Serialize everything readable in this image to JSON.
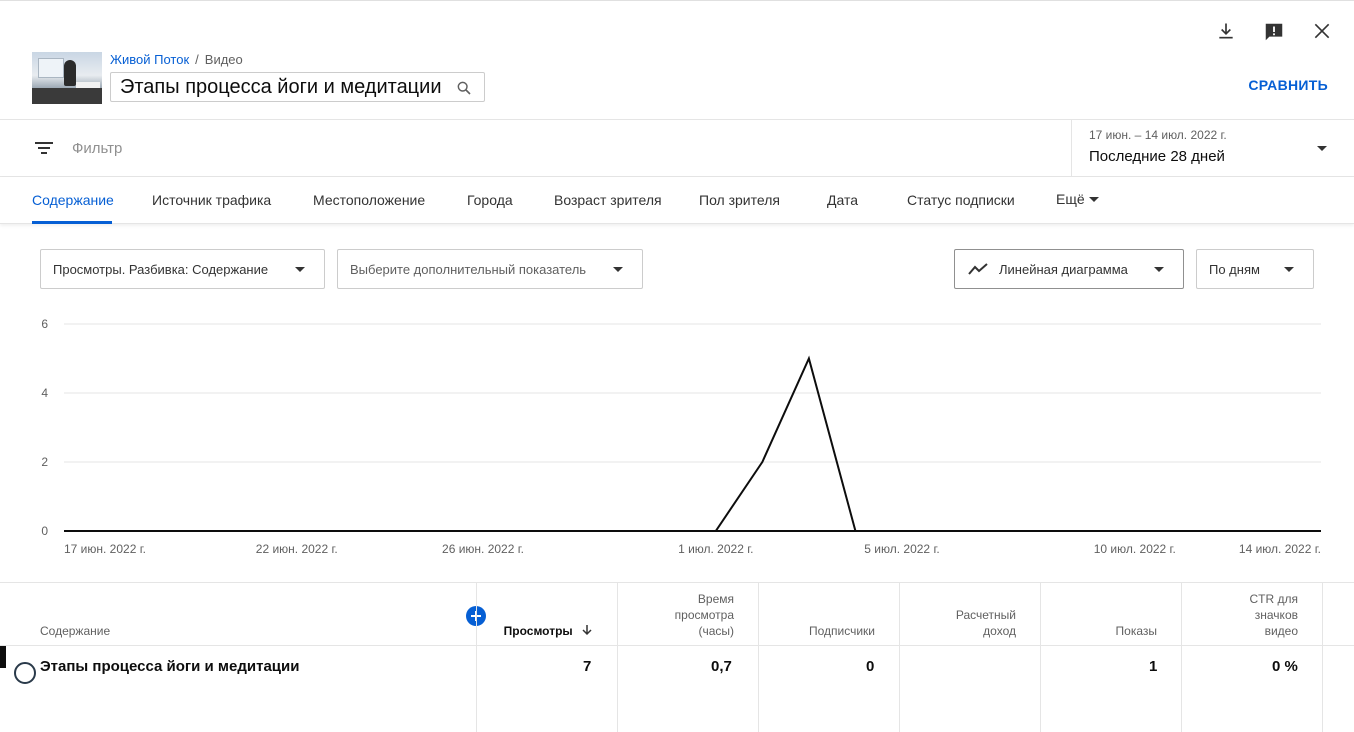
{
  "header": {
    "breadcrumb_channel": "Живой Поток",
    "breadcrumb_separator": "/",
    "breadcrumb_section": "Видео",
    "video_title": "Этапы процесса йоги и медитации",
    "compare_label": "СРАВНИТЬ",
    "icons": [
      "download-icon",
      "feedback-icon",
      "close-icon",
      "search-icon"
    ]
  },
  "filter": {
    "placeholder": "Фильтр",
    "date_range": "17 июн. – 14 июл. 2022 г.",
    "date_preset": "Последние 28 дней"
  },
  "tabs": [
    {
      "label": "Содержание",
      "active": true
    },
    {
      "label": "Источник трафика"
    },
    {
      "label": "Местоположение"
    },
    {
      "label": "Города"
    },
    {
      "label": "Возраст зрителя"
    },
    {
      "label": "Пол зрителя"
    },
    {
      "label": "Дата"
    },
    {
      "label": "Статус подписки"
    },
    {
      "label": "Ещё"
    }
  ],
  "controls": {
    "metric": "Просмотры. Разбивка: Содержание",
    "secondary_metric": "Выберите дополнительный показатель",
    "chart_type": "Линейная диаграмма",
    "interval": "По дням"
  },
  "chart_data": {
    "type": "line",
    "x": [
      "17 июн.",
      "18 июн.",
      "19 июн.",
      "20 июн.",
      "21 июн.",
      "22 июн.",
      "23 июн.",
      "24 июн.",
      "25 июн.",
      "26 июн.",
      "27 июн.",
      "28 июн.",
      "29 июн.",
      "30 июн.",
      "1 июл.",
      "2 июл.",
      "3 июл.",
      "4 июл.",
      "5 июл.",
      "6 июл.",
      "7 июл.",
      "8 июл.",
      "9 июл.",
      "10 июл.",
      "11 июл.",
      "12 июл.",
      "13 июл.",
      "14 июл."
    ],
    "series": [
      {
        "values": [
          0,
          0,
          0,
          0,
          0,
          0,
          0,
          0,
          0,
          0,
          0,
          0,
          0,
          0,
          0,
          2,
          5,
          0,
          0,
          0,
          0,
          0,
          0,
          0,
          0,
          0,
          0,
          0
        ]
      }
    ],
    "ylim": [
      0,
      6
    ],
    "yticks": [
      "0",
      "2",
      "4",
      "6"
    ],
    "xtick_labels": [
      "17 июн. 2022 г.",
      "22 июн. 2022 г.",
      "26 июн. 2022 г.",
      "1 июл. 2022 г.",
      "5 июл. 2022 г.",
      "10 июл. 2022 г.",
      "14 июл. 2022 г."
    ],
    "xtick_index": [
      0,
      5,
      9,
      14,
      18,
      23,
      27
    ],
    "grid": true,
    "color": "#0d0d0d"
  },
  "table": {
    "columns": [
      {
        "label": "Содержание"
      },
      {
        "label": "Просмотры"
      },
      {
        "label": "Время просмотра (часы)"
      },
      {
        "label": "Подписчики"
      },
      {
        "label": "Расчетный доход"
      },
      {
        "label": "Показы"
      },
      {
        "label": "CTR для значков видео"
      }
    ],
    "rows": [
      {
        "title": "Этапы процесса йоги и медитации",
        "views": "7",
        "watch_time": "0,7",
        "subscribers": "0",
        "revenue": "",
        "impressions": "1",
        "ctr": "0 %"
      }
    ]
  },
  "colors": {
    "accent": "#065fd4",
    "text": "#0d0d0d",
    "muted": "#606060",
    "border": "#e5e5e5"
  }
}
